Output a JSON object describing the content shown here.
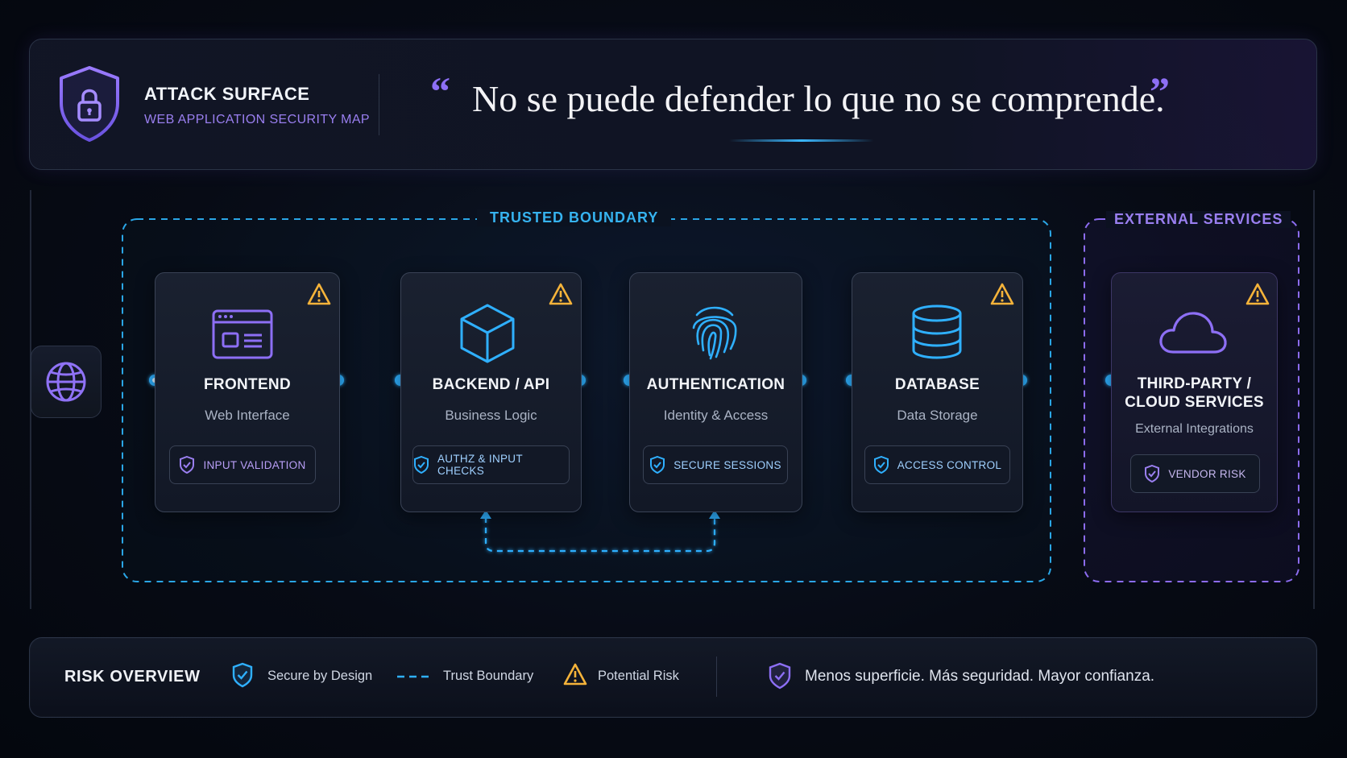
{
  "header": {
    "title": "ATTACK SURFACE",
    "subtitle": "WEB APPLICATION SECURITY MAP",
    "quote": "No se puede defender lo que no se comprende.",
    "quote_open": "“",
    "quote_close": "”"
  },
  "boundaries": {
    "trusted": "TRUSTED BOUNDARY",
    "external": "EXTERNAL SERVICES"
  },
  "nodes": [
    {
      "title": "FRONTEND",
      "subtitle": "Web Interface",
      "control": "INPUT VALIDATION",
      "icon": "browser-window-icon",
      "risk": true
    },
    {
      "title": "BACKEND / API",
      "subtitle": "Business Logic",
      "control": "AUTHZ & INPUT CHECKS",
      "icon": "cube-icon",
      "risk": true
    },
    {
      "title": "AUTHENTICATION",
      "subtitle": "Identity & Access",
      "control": "SECURE SESSIONS",
      "icon": "fingerprint-icon",
      "risk": false
    },
    {
      "title": "DATABASE",
      "subtitle": "Data Storage",
      "control": "ACCESS CONTROL",
      "icon": "database-icon",
      "risk": true
    },
    {
      "title_line1": "THIRD-PARTY /",
      "title_line2": "CLOUD SERVICES",
      "subtitle": "External Integrations",
      "control": "VENDOR RISK",
      "icon": "cloud-icon",
      "risk": true
    }
  ],
  "footer": {
    "title": "RISK OVERVIEW",
    "legend": [
      "Secure by Design",
      "Trust Boundary",
      "Potential Risk"
    ],
    "tagline": "Menos superficie. Más seguridad. Mayor confianza."
  },
  "colors": {
    "accent_blue": "#2fb0ff",
    "accent_purple": "#8d6ff5",
    "warning": "#f5b33a",
    "background": "#070b15"
  }
}
